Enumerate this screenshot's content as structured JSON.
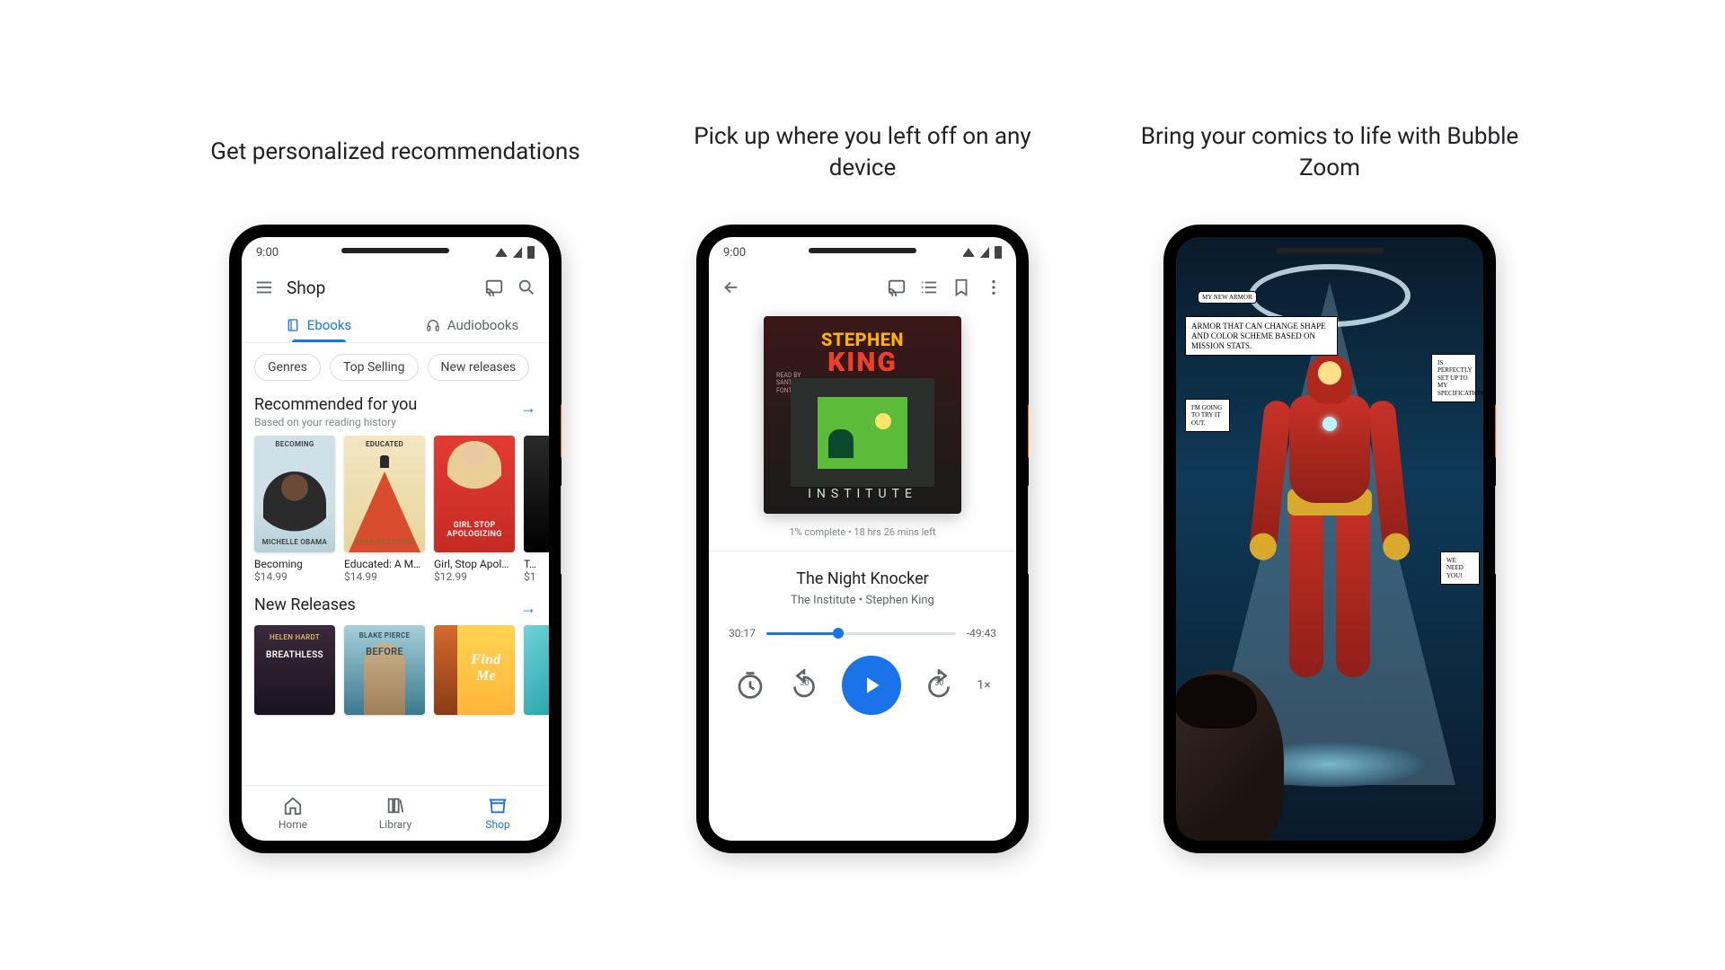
{
  "captions": {
    "c1": "Get personalized recommendations",
    "c2": "Pick up where you left off on any device",
    "c3": "Bring your comics to life with Bubble Zoom"
  },
  "status": {
    "time": "9:00"
  },
  "shop": {
    "title": "Shop",
    "tabs": {
      "ebooks": "Ebooks",
      "audiobooks": "Audiobooks"
    },
    "chips": {
      "genres": "Genres",
      "top": "Top Selling",
      "new": "New releases"
    },
    "recommended": {
      "title": "Recommended for you",
      "sub": "Based on your reading history"
    },
    "books": [
      {
        "title": "Becoming",
        "price": "$14.99",
        "cover_top": "Becoming",
        "cover_bot": "Michelle Obama"
      },
      {
        "title": "Educated: A M…",
        "price": "$14.99",
        "cover_top": "Educated",
        "cover_bot": "Tara Westover"
      },
      {
        "title": "Girl, Stop Apol…",
        "price": "$12.99",
        "cover_mid": "Girl Stop Apologizing"
      },
      {
        "title": "T…",
        "price": "$1"
      }
    ],
    "newreleases": {
      "title": "New Releases"
    },
    "books2": [
      {
        "cover_top": "Helen Hardt",
        "cover_mid": "Breathless"
      },
      {
        "cover_top": "Blake Pierce",
        "cover_mid": "Before"
      },
      {
        "cover_mid": "Find Me"
      },
      {
        "cover_mid": ""
      }
    ],
    "nav": {
      "home": "Home",
      "library": "Library",
      "shop": "Shop"
    }
  },
  "player": {
    "album": {
      "author1": "STEPHEN",
      "author2": "KING",
      "title": "INSTITUTE",
      "read": "READ BY\nSANTINO\nFONTANA"
    },
    "meta": "1% complete • 18 hrs 26 mins left",
    "chapter": "The Night Knocker",
    "book": "The Institute • Stephen King",
    "elapsed": "30:17",
    "remaining": "-49:43",
    "progress_pct": 38,
    "skip": "30",
    "speed": "1×"
  },
  "comic": {
    "tag": "MY NEW ARMOR",
    "main": "ARMOR THAT CAN CHANGE SHAPE AND COLOR SCHEME BASED ON MISSION STATS.",
    "r1": "IS PERFECTLY SET UP TO MY SPECIFICATIONS.",
    "l2": "I'M GOING TO TRY IT OUT.",
    "r2": "WE NEED YOU!"
  }
}
